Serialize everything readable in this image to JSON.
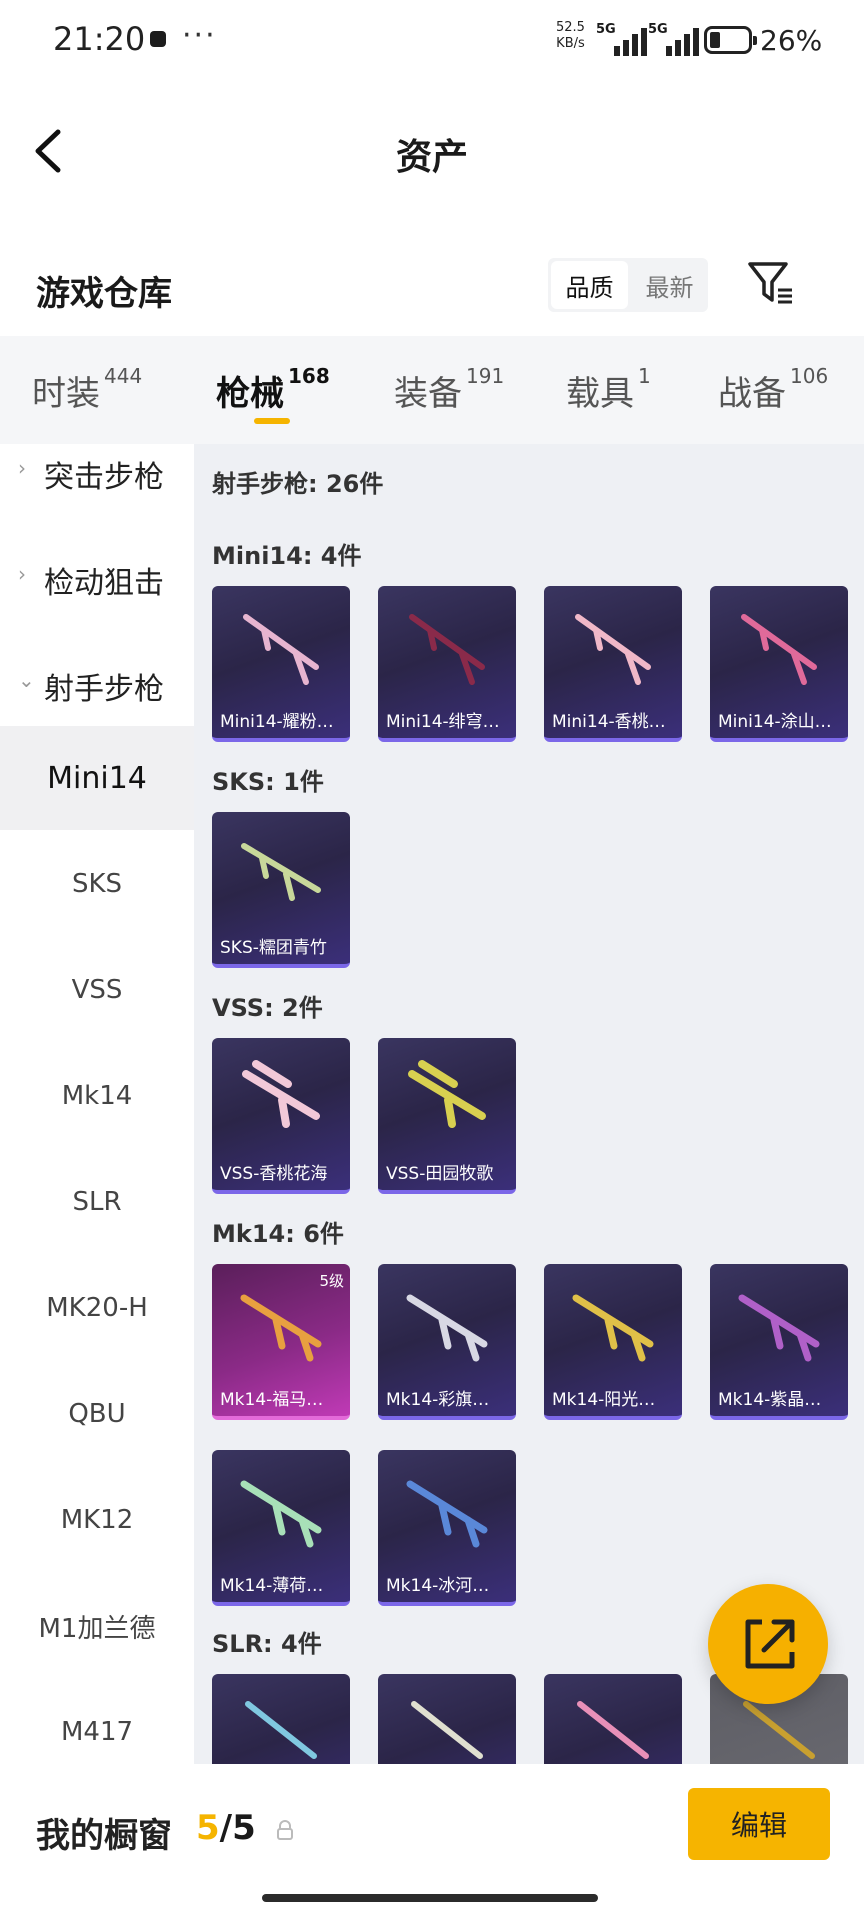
{
  "status_bar": {
    "time": "21:20",
    "more": "···",
    "speed_value": "52.5",
    "speed_unit": "KB/s",
    "network1": "5G",
    "network2": "5G",
    "battery": "26%"
  },
  "header": {
    "title": "资产"
  },
  "warehouse": {
    "title": "游戏仓库",
    "sort_options": [
      "品质",
      "最新"
    ],
    "sort_selected": "品质"
  },
  "tabs": [
    {
      "label": "时装",
      "count": "444"
    },
    {
      "label": "枪械",
      "count": "168",
      "active": true
    },
    {
      "label": "装备",
      "count": "191"
    },
    {
      "label": "载具",
      "count": "1"
    },
    {
      "label": "战备",
      "count": "106"
    }
  ],
  "sidebar": {
    "groups": [
      {
        "label": "突击步枪",
        "chevron": "›"
      },
      {
        "label": "检动狙击",
        "chevron": "›"
      },
      {
        "label": "射手步枪",
        "chevron": "⌄"
      }
    ],
    "items": [
      "Mini14",
      "SKS",
      "VSS",
      "Mk14",
      "SLR",
      "MK20-H",
      "QBU",
      "MK12",
      "M1加兰德",
      "M417"
    ],
    "active_item": "Mini14"
  },
  "content": {
    "category_title": "射手步枪: 26件",
    "sections": [
      {
        "title": "Mini14: 4件",
        "cards": [
          "Mini14-耀粉…",
          "Mini14-绯穹…",
          "Mini14-香桃…",
          "Mini14-涂山…"
        ]
      },
      {
        "title": "SKS: 1件",
        "cards": [
          "SKS-糯团青竹"
        ]
      },
      {
        "title": "VSS: 2件",
        "cards": [
          "VSS-香桃花海",
          "VSS-田园牧歌"
        ]
      },
      {
        "title": "Mk14: 6件",
        "cards": [
          "Mk14-福马…",
          "Mk14-彩旗…",
          "Mk14-阳光…",
          "Mk14-紫晶…",
          "Mk14-薄荷…",
          "Mk14-冰河…"
        ],
        "level_badge": "5级"
      },
      {
        "title": "SLR: 4件",
        "cards": [
          "",
          "",
          "",
          ""
        ]
      }
    ]
  },
  "bottom_bar": {
    "label": "我的橱窗",
    "current": "5",
    "total": "/5",
    "edit_label": "编辑"
  },
  "colors": {
    "accent": "#f6b400",
    "card_bg": "#2b2548",
    "card_border": "#7b67e8",
    "card_pink": "#c03ab6"
  },
  "icons": {
    "back": "chevron-left-icon",
    "filter": "filter-icon",
    "share": "share-icon",
    "lock": "lock-icon"
  }
}
